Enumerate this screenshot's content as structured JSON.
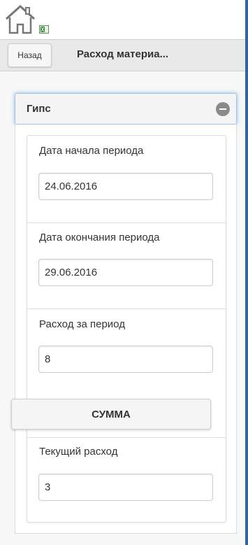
{
  "topbar": {
    "home_icon": "home-icon",
    "mini_icon": "excel-file-icon"
  },
  "header": {
    "back_label": "Назад",
    "title": "Расход материа..."
  },
  "section": {
    "title": "Гипс",
    "toggle_icon": "minus-circle-icon"
  },
  "fields": {
    "start_date": {
      "label": "Дата начала периода",
      "value": "24.06.2016"
    },
    "end_date": {
      "label": "Дата окончания периода",
      "value": "29.06.2016"
    },
    "period_usage": {
      "label": "Расход за период",
      "value": "8"
    },
    "current_usage": {
      "label": "Текущий расход",
      "value": "3"
    }
  },
  "sum_button_label": "СУММА",
  "colors": {
    "frame_border": "#2f64a6",
    "focus_glow": "#3888d8"
  }
}
